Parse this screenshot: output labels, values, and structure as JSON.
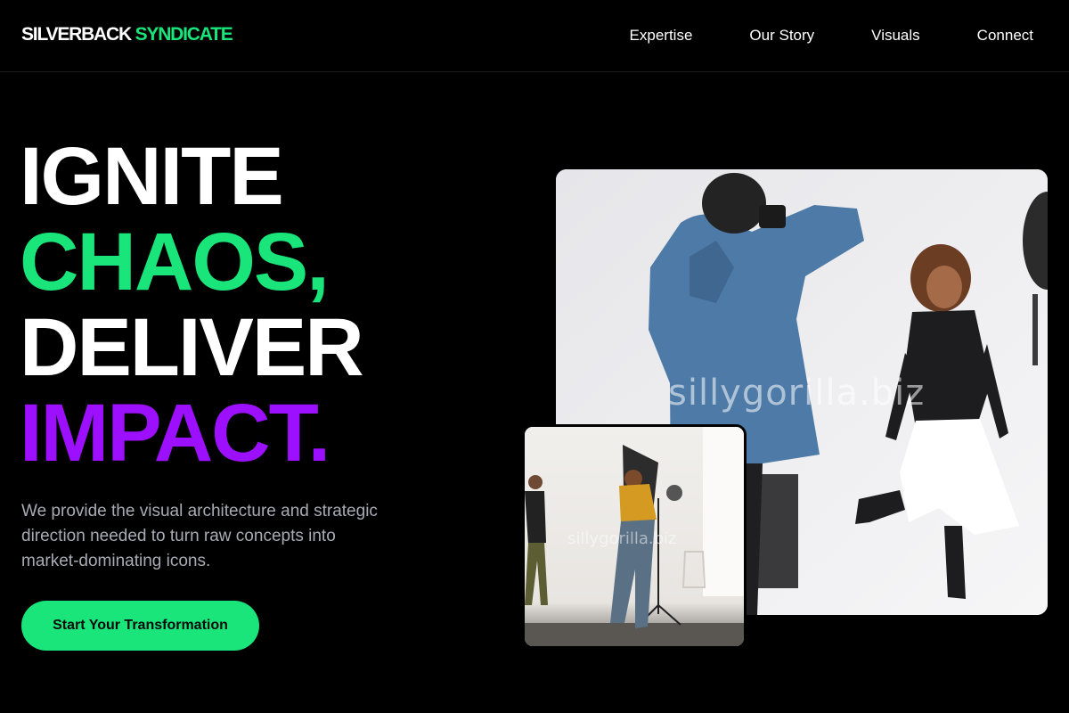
{
  "brand": {
    "name_part1": "SILVERBACK",
    "name_part2": "SYNDICATE"
  },
  "nav": {
    "items": [
      {
        "label": "Expertise"
      },
      {
        "label": "Our Story"
      },
      {
        "label": "Visuals"
      },
      {
        "label": "Connect"
      }
    ]
  },
  "hero": {
    "line1": "IGNITE",
    "line2": "CHAOS,",
    "line3": "DELIVER",
    "line4": "IMPACT.",
    "description": "We provide the visual architecture and strategic direction needed to turn raw concepts into market-dominating icons.",
    "cta_label": "Start Your Transformation"
  },
  "images": {
    "main_watermark": "sillygorilla.biz",
    "small_watermark": "sillygorilla.biz"
  },
  "colors": {
    "accent_green": "#19e57a",
    "accent_purple": "#9d10ff",
    "background": "#000000",
    "muted_text": "#a7abb4"
  }
}
